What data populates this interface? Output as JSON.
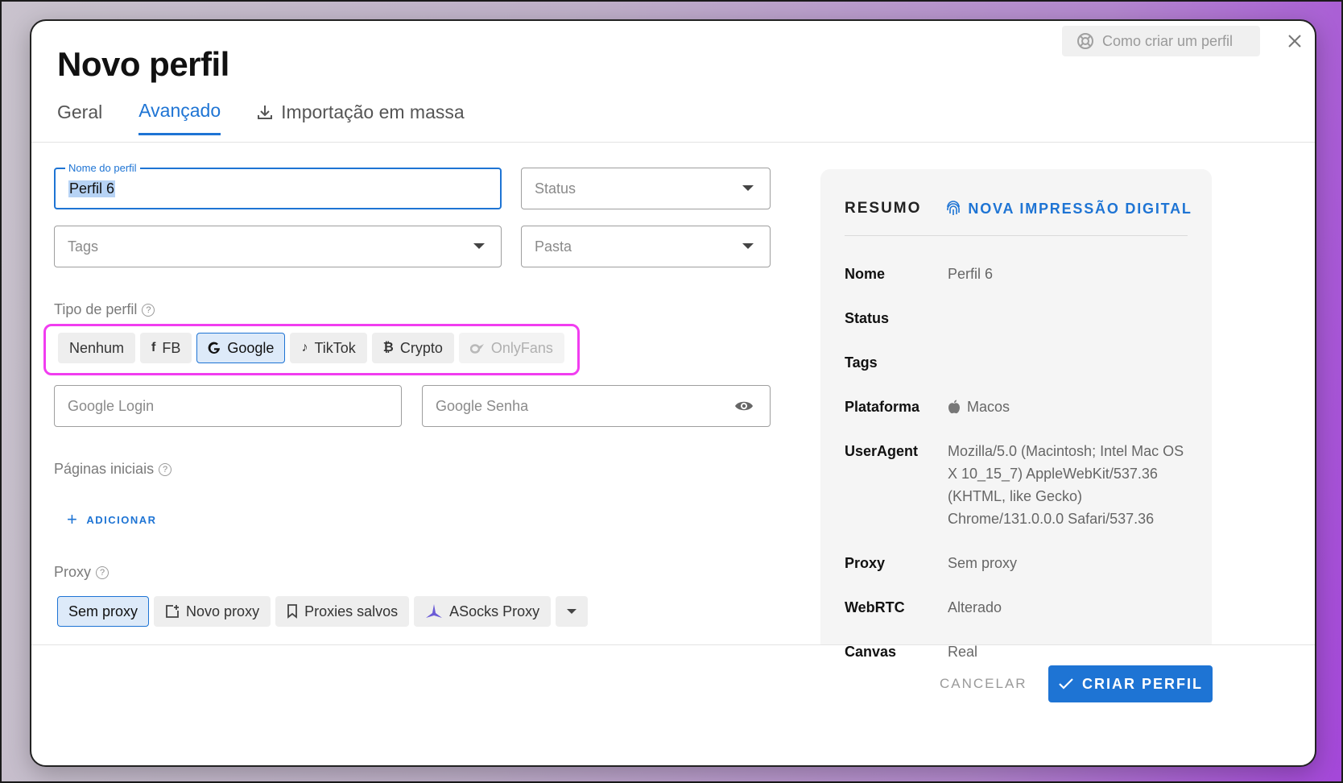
{
  "dialog": {
    "title": "Novo perfil",
    "help_label": "Como criar um perfil",
    "close_icon": "close-icon"
  },
  "tabs": [
    {
      "label": "Geral",
      "active": false
    },
    {
      "label": "Avançado",
      "active": true
    },
    {
      "label": "Importação em massa",
      "icon": "download-icon",
      "active": false
    }
  ],
  "form": {
    "profile_name": {
      "label": "Nome do perfil",
      "value": "Perfil 6"
    },
    "status": {
      "placeholder": "Status"
    },
    "tags": {
      "placeholder": "Tags"
    },
    "folder": {
      "placeholder": "Pasta"
    },
    "profile_type": {
      "label": "Tipo de perfil",
      "options": [
        {
          "label": "Nenhum",
          "icon": ""
        },
        {
          "label": "FB",
          "icon": "facebook-icon"
        },
        {
          "label": "Google",
          "icon": "google-icon",
          "selected": true
        },
        {
          "label": "TikTok",
          "icon": "tiktok-icon"
        },
        {
          "label": "Crypto",
          "icon": "bitcoin-icon"
        },
        {
          "label": "OnlyFans",
          "icon": "onlyfans-icon",
          "disabled": true
        }
      ]
    },
    "google_login": {
      "placeholder": "Google Login"
    },
    "google_password": {
      "placeholder": "Google Senha"
    },
    "start_pages": {
      "label": "Páginas iniciais",
      "add_label": "ADICIONAR"
    },
    "proxy": {
      "label": "Proxy",
      "options": [
        {
          "label": "Sem proxy",
          "selected": true
        },
        {
          "label": "Novo proxy",
          "icon": "add-box-icon"
        },
        {
          "label": "Proxies salvos",
          "icon": "bookmark-icon"
        },
        {
          "label": "ASocks Proxy",
          "icon": "asocks-logo-icon"
        }
      ]
    }
  },
  "summary": {
    "title": "RESUMO",
    "new_fingerprint_label": "NOVA IMPRESSÃO DIGITAL",
    "rows": [
      {
        "key": "Nome",
        "value": "Perfil 6"
      },
      {
        "key": "Status",
        "value": ""
      },
      {
        "key": "Tags",
        "value": ""
      },
      {
        "key": "Plataforma",
        "value": "Macos"
      },
      {
        "key": "UserAgent",
        "value": "Mozilla/5.0 (Macintosh; Intel Mac OS X 10_15_7) AppleWebKit/537.36 (KHTML, like Gecko) Chrome/131.0.0.0 Safari/537.36"
      },
      {
        "key": "Proxy",
        "value": "Sem proxy"
      },
      {
        "key": "WebRTC",
        "value": "Alterado"
      },
      {
        "key": "Canvas",
        "value": "Real"
      }
    ]
  },
  "footer": {
    "cancel_label": "CANCELAR",
    "create_label": "CRIAR PERFIL"
  },
  "colors": {
    "accent": "#1e74d4",
    "highlight_border": "#f13df0"
  }
}
